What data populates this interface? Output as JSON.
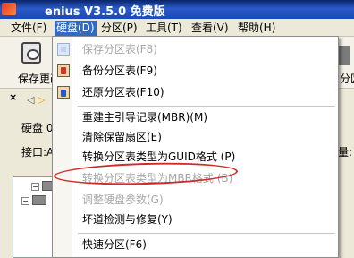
{
  "window": {
    "title": "enius V3.5.0 免费版"
  },
  "menubar": {
    "items": [
      "文件(F)",
      "硬盘(D)",
      "分区(P)",
      "工具(T)",
      "查看(V)",
      "帮助(H)"
    ]
  },
  "toolbar": {
    "left_label": "保存更改",
    "right_label": "分区"
  },
  "panel": {
    "close_glyph": "×",
    "disk_label": "硬盘 0",
    "port_label": "接口:A",
    "right_cell": "量:"
  },
  "dropdown": {
    "items": [
      {
        "label": "保存分区表(F8)",
        "icon": "save-disk-icon",
        "disabled": true
      },
      {
        "label": "备份分区表(F9)",
        "icon": "backup-icon",
        "disabled": false
      },
      {
        "label": "还原分区表(F10)",
        "icon": "restore-icon",
        "disabled": false
      },
      {
        "label": "重建主引导记录(MBR)(M)",
        "disabled": false
      },
      {
        "label": "清除保留扇区(E)",
        "disabled": false
      },
      {
        "label": "转换分区表类型为GUID格式 (P)",
        "disabled": false
      },
      {
        "label": "转换分区表类型为MBR格式 (B)",
        "disabled": true
      },
      {
        "label": "调整硬盘参数(G)",
        "disabled": true
      },
      {
        "label": "坏道检测与修复(Y)",
        "disabled": false
      },
      {
        "label": "快速分区(F6)",
        "disabled": false
      }
    ]
  },
  "colors": {
    "menu_highlight": "#316ac5",
    "annotation": "#d12a2a",
    "disabled_text": "#a7a7a7"
  }
}
